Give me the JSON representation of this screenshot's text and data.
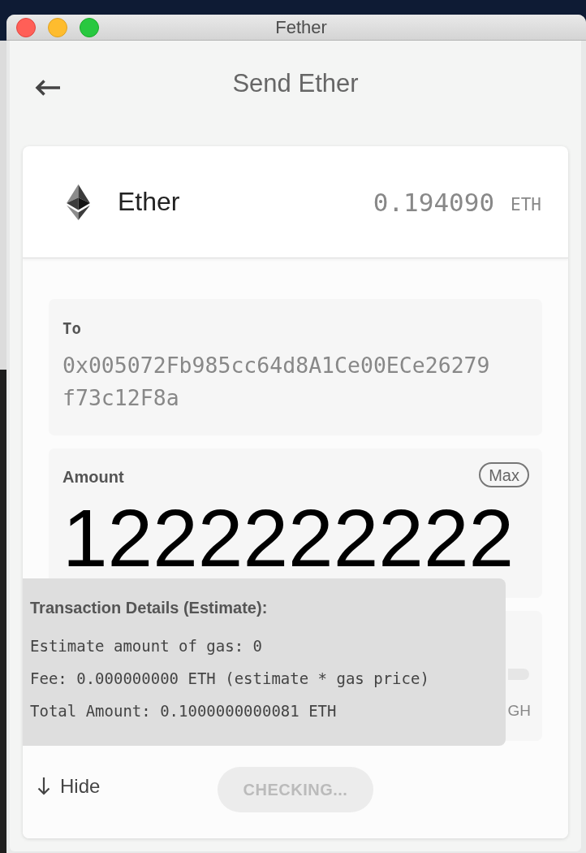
{
  "window": {
    "title": "Fether"
  },
  "header": {
    "title": "Send Ether"
  },
  "token": {
    "name": "Ether",
    "balance": "0.194090",
    "unit": "ETH"
  },
  "to_field": {
    "label": "To",
    "value": "0x005072Fb985cc64d8A1Ce00ECe26279f73c12F8a"
  },
  "amount_field": {
    "label": "Amount",
    "max_button": "Max",
    "value": "1222222222"
  },
  "slider_field": {
    "right_label": "GH"
  },
  "details_popup": {
    "title": "Transaction Details (Estimate):",
    "lines": [
      "Estimate amount of gas: 0",
      "Fee: 0.000000000 ETH (estimate * gas price)",
      "Total Amount: 0.1000000000081 ETH"
    ]
  },
  "hide_button": {
    "label": "Hide"
  },
  "submit_button": {
    "label": "CHECKING...",
    "disabled": true
  }
}
